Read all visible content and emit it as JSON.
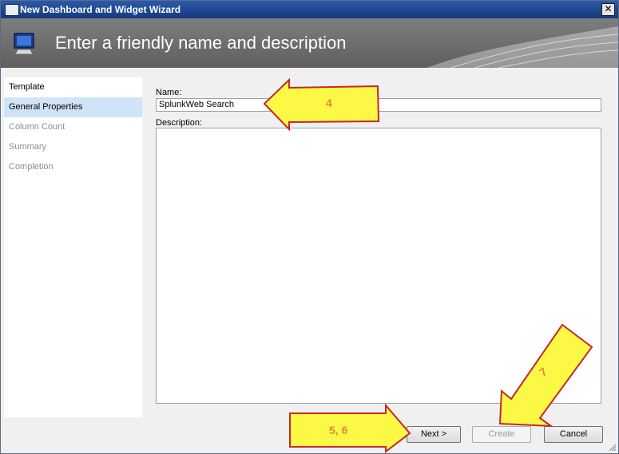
{
  "window": {
    "title": "New Dashboard and Widget Wizard",
    "close_glyph": "✕"
  },
  "banner": {
    "heading": "Enter a friendly name and description",
    "icon": "monitor-icon"
  },
  "sidebar": {
    "items": [
      {
        "label": "Template",
        "state": "normal"
      },
      {
        "label": "General Properties",
        "state": "active"
      },
      {
        "label": "Column Count",
        "state": "disabled"
      },
      {
        "label": "Summary",
        "state": "disabled"
      },
      {
        "label": "Completion",
        "state": "disabled"
      }
    ]
  },
  "form": {
    "name_label": "Name:",
    "name_value": "SplunkWeb Search",
    "description_label": "Description:",
    "description_value": ""
  },
  "buttons": {
    "next": "Next >",
    "create": "Create",
    "cancel": "Cancel"
  },
  "annotations": {
    "arrow_name": "4",
    "arrow_next": "5, 6",
    "arrow_create": "7",
    "arrow_fill": "#fbf846",
    "arrow_stroke": "#c62828"
  }
}
